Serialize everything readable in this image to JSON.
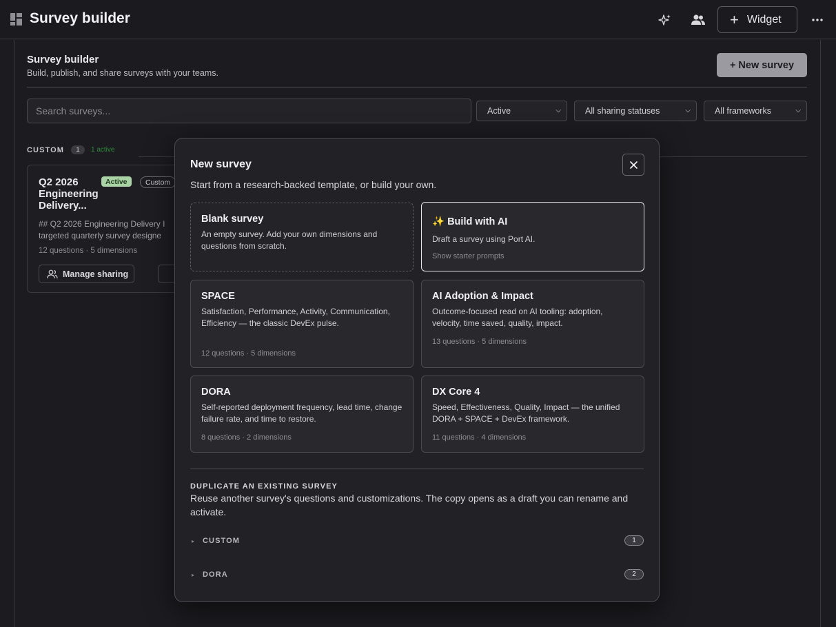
{
  "topbar": {
    "title": "Survey builder",
    "icons": [
      "dashboard-icon",
      "sparkle-icon",
      "users-icon",
      "more-icon"
    ],
    "widget_label": "Widget"
  },
  "main": {
    "title": "Survey builder",
    "subtitle": "Build, publish, and share surveys with your teams.",
    "new_survey_label": "+ New survey",
    "search_placeholder": "Search surveys...",
    "filters": {
      "status": "Active",
      "sharing": "All sharing statuses",
      "frameworks": "All frameworks"
    },
    "group": {
      "label": "CUSTOM",
      "count": "1",
      "active_text": "1 active"
    },
    "card": {
      "title": "Q2 2026 Engineering Delivery...",
      "status_badge": "Active",
      "type_badge": "Custom",
      "desc_line1": "## Q2 2026 Engineering Delivery I",
      "desc_line2": "targeted quarterly survey designe",
      "meta": "12 questions · 5 dimensions",
      "manage_label": "Manage sharing"
    }
  },
  "modal": {
    "title": "New survey",
    "subtitle": "Start from a research-backed template, or build your own.",
    "templates": [
      {
        "title": "Blank survey",
        "desc": "An empty survey. Add your own dimensions and questions from scratch.",
        "meta": ""
      },
      {
        "title": "✨ Build with AI",
        "desc": "Draft a survey using Port AI.",
        "meta": "Show starter prompts"
      },
      {
        "title": "SPACE",
        "desc": "Satisfaction, Performance, Activity, Communication, Efficiency — the classic DevEx pulse.",
        "meta": "12 questions · 5 dimensions"
      },
      {
        "title": "AI Adoption & Impact",
        "desc": "Outcome-focused read on AI tooling: adoption, velocity, time saved, quality, impact.",
        "meta": "13 questions · 5 dimensions"
      },
      {
        "title": "DORA",
        "desc": "Self-reported deployment frequency, lead time, change failure rate, and time to restore.",
        "meta": "8 questions · 2 dimensions"
      },
      {
        "title": "DX Core 4",
        "desc": "Speed, Effectiveness, Quality, Impact — the unified DORA + SPACE + DevEx framework.",
        "meta": "11 questions · 4 dimensions"
      }
    ],
    "duplicate": {
      "title": "DUPLICATE AN EXISTING SURVEY",
      "desc": "Reuse another survey's questions and customizations. The copy opens as a draft you can rename and activate.",
      "groups": [
        {
          "label": "CUSTOM",
          "count": "1"
        },
        {
          "label": "DORA",
          "count": "2"
        }
      ]
    }
  }
}
